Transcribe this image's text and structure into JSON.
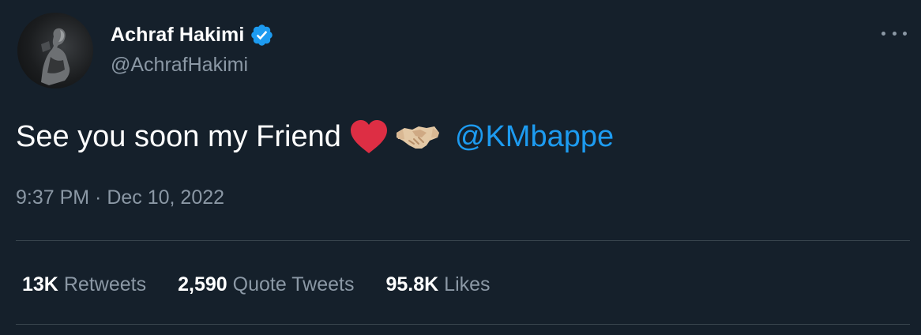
{
  "author": {
    "display_name": "Achraf Hakimi",
    "handle": "@AchrafHakimi",
    "verified_icon": "verified-badge-icon",
    "accent_color": "#1d9bf0"
  },
  "more_icon": "more-options-icon",
  "tweet": {
    "text": "See you soon my Friend",
    "emojis": [
      "red-heart",
      "handshake"
    ],
    "mention": "@KMbappe"
  },
  "timestamp": "9:37 PM · Dec 10, 2022",
  "stats": [
    {
      "value": "13K",
      "label": "Retweets"
    },
    {
      "value": "2,590",
      "label": "Quote Tweets"
    },
    {
      "value": "95.8K",
      "label": "Likes"
    }
  ],
  "colors": {
    "background": "#15202b",
    "primary_text": "#ffffff",
    "secondary_text": "#8b98a5",
    "divider": "#38444d",
    "link": "#1d9bf0"
  }
}
